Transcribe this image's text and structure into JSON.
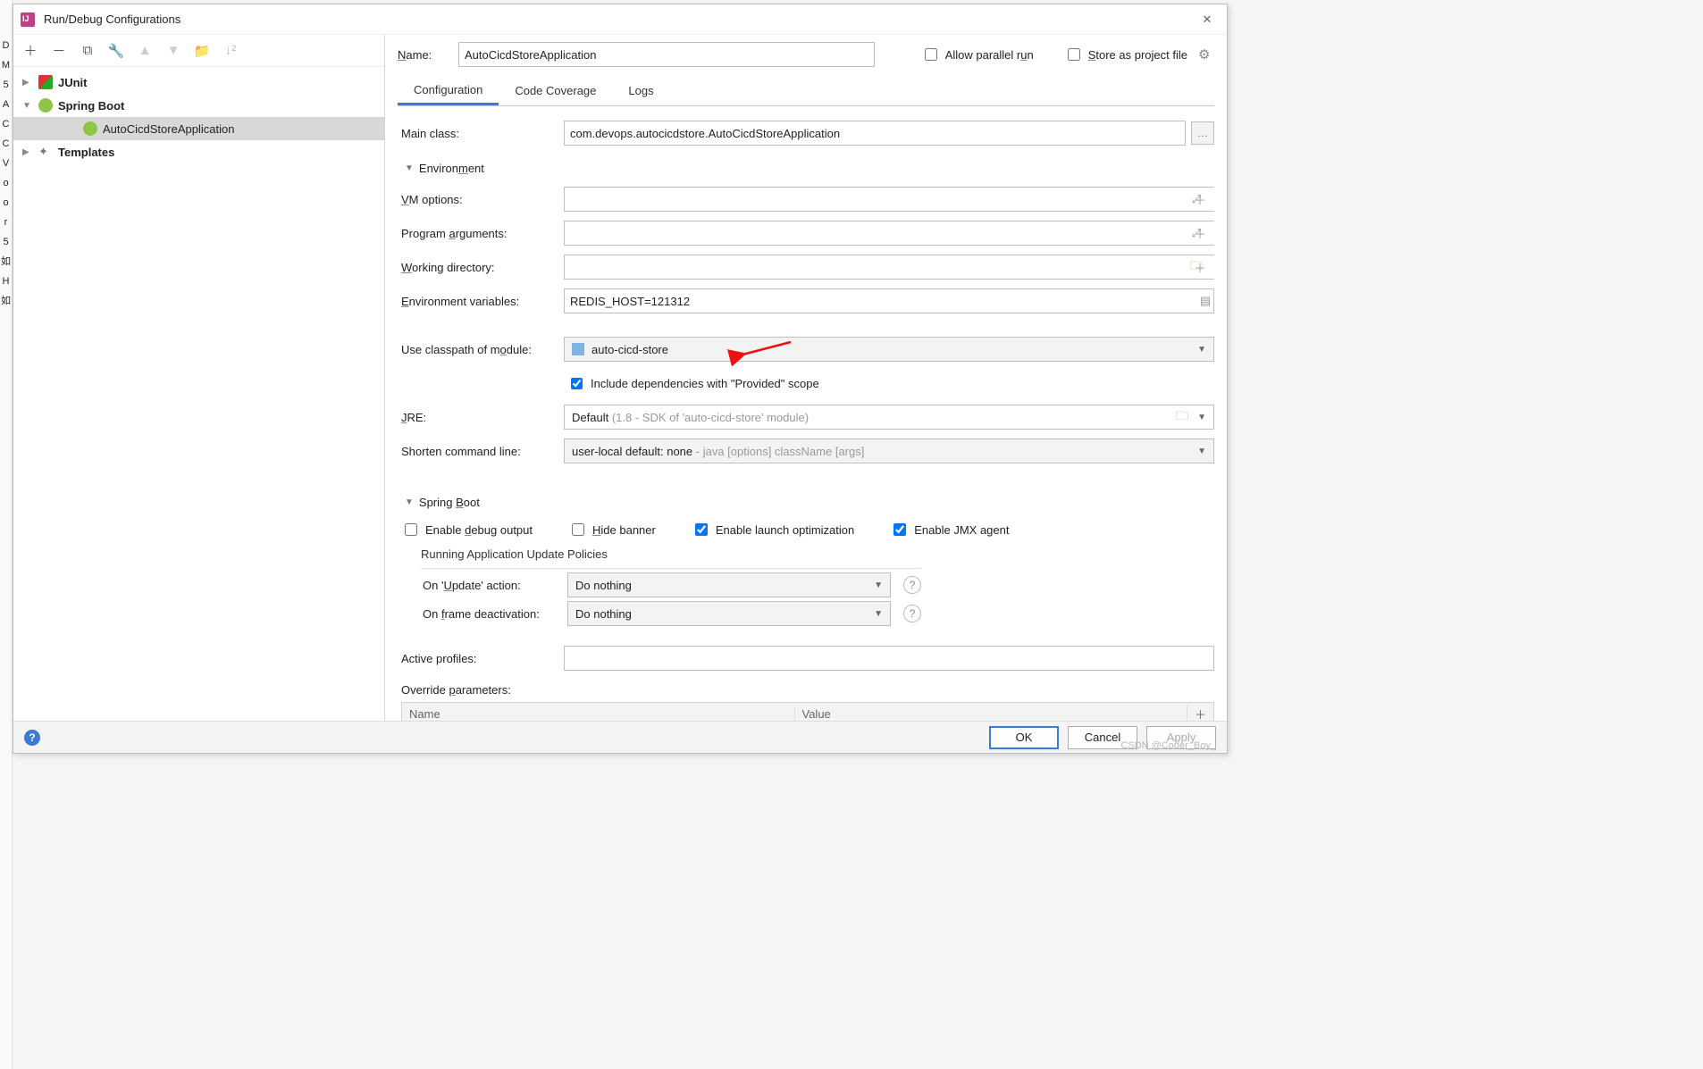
{
  "left_gutter": [
    "D",
    "M",
    "5",
    "A",
    "C",
    "C",
    "V",
    "o",
    "o",
    "r",
    "5",
    "如",
    "H",
    "如"
  ],
  "dialog": {
    "title": "Run/Debug Configurations",
    "tree": {
      "junit": "JUnit",
      "spring_boot": "Spring Boot",
      "app": "AutoCicdStoreApplication",
      "templates": "Templates"
    },
    "name_label": "Name:",
    "name_value": "AutoCicdStoreApplication",
    "allow_parallel": "Allow parallel run",
    "store_as_project": "Store as project file",
    "tabs": {
      "config": "Configuration",
      "coverage": "Code Coverage",
      "logs": "Logs"
    },
    "form": {
      "main_class_label": "Main class:",
      "main_class_value": "com.devops.autocicdstore.AutoCicdStoreApplication",
      "env_section": "Environment",
      "vm_label": "VM options:",
      "vm_value": "",
      "prog_args_label": "Program arguments:",
      "prog_args_value": "",
      "workdir_label": "Working directory:",
      "workdir_value": "",
      "envvars_label": "Environment variables:",
      "envvars_value": "REDIS_HOST=121312",
      "classpath_label": "Use classpath of module:",
      "classpath_value": "auto-cicd-store",
      "include_provided": "Include dependencies with \"Provided\" scope",
      "jre_label": "JRE:",
      "jre_default": "Default",
      "jre_hint": " (1.8 - SDK of 'auto-cicd-store' module)",
      "shorten_label": "Shorten command line:",
      "shorten_value": "user-local default: none",
      "shorten_hint": " - java [options] className [args]",
      "spring_section": "Spring Boot",
      "enable_debug": "Enable debug output",
      "hide_banner": "Hide banner",
      "enable_launch": "Enable launch optimization",
      "enable_jmx": "Enable JMX agent",
      "update_title": "Running Application Update Policies",
      "on_update_label": "On 'Update' action:",
      "on_update_value": "Do nothing",
      "on_frame_label": "On frame deactivation:",
      "on_frame_value": "Do nothing",
      "active_profiles_label": "Active profiles:",
      "active_profiles_value": "",
      "override_label": "Override parameters:",
      "override_cols": {
        "name": "Name",
        "value": "Value"
      }
    },
    "footer": {
      "ok": "OK",
      "cancel": "Cancel",
      "apply": "Apply"
    },
    "watermark": "CSDN @Coder_Boy_"
  }
}
